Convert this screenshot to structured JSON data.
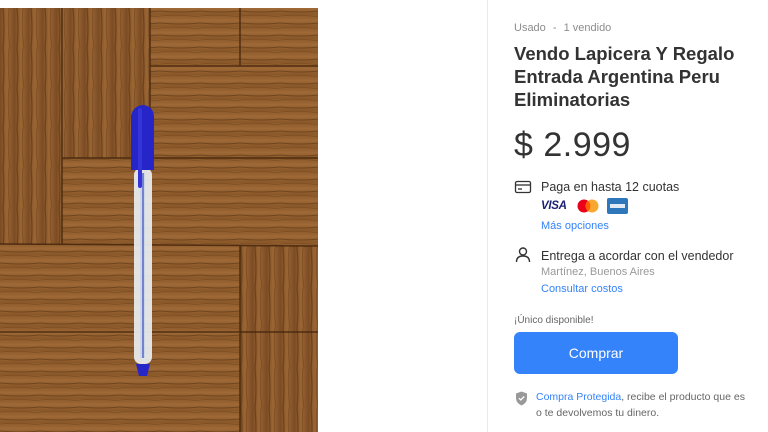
{
  "product": {
    "condition": "Usado",
    "separator": "-",
    "sold_count": "1 vendido",
    "title": "Vendo Lapicera Y Regalo Entrada Argentina Peru Eliminatorias",
    "price": "$ 2.999"
  },
  "payment": {
    "icon": "credit-card-icon",
    "label": "Paga en hasta 12 cuotas",
    "cards": [
      "VISA",
      "mastercard-logo",
      "amex-logo"
    ],
    "more_link": "Más opciones"
  },
  "delivery": {
    "icon": "person-icon",
    "label": "Entrega a acordar con el vendedor",
    "location": "Martínez, Buenos Aires",
    "costs_link": "Consultar costos"
  },
  "purchase": {
    "stock_label": "¡Único disponible!",
    "buy_button": "Comprar"
  },
  "protection": {
    "icon": "shield-icon",
    "link": "Compra Protegida",
    "text_1": ", recibe el producto que es",
    "text_2": "o te devolvemos tu dinero."
  },
  "colors": {
    "accent": "#3483fa",
    "pen_blue": "#2626c8",
    "wood": "#8b5a2b"
  }
}
